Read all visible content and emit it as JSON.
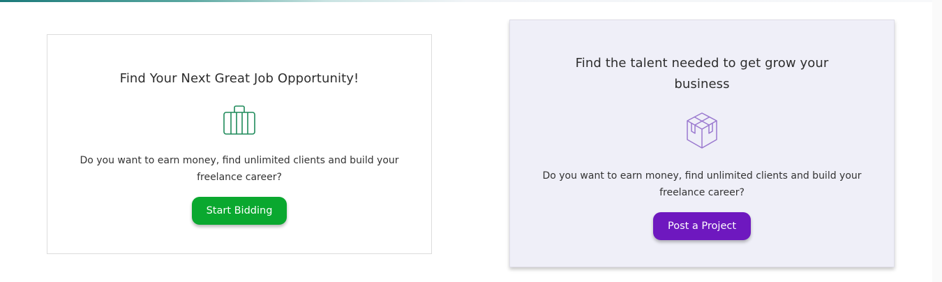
{
  "colors": {
    "green_button": "#0aa82f",
    "purple_button": "#6e18bf",
    "briefcase_icon": "#1e8a5a",
    "cube_icon": "#9a78cf",
    "right_card_background": "#efeff8"
  },
  "freelancer_card": {
    "title": "Find Your Next Great Job Opportunity!",
    "icon": "briefcase-icon",
    "description": "Do you want to earn money, find unlimited clients and build your freelance career?",
    "button_label": "Start Bidding"
  },
  "client_card": {
    "title": "Find the talent needed to get grow your business",
    "icon": "cube-icon",
    "description": "Do you want to earn money, find unlimited clients and build your freelance career?",
    "button_label": "Post a Project"
  }
}
